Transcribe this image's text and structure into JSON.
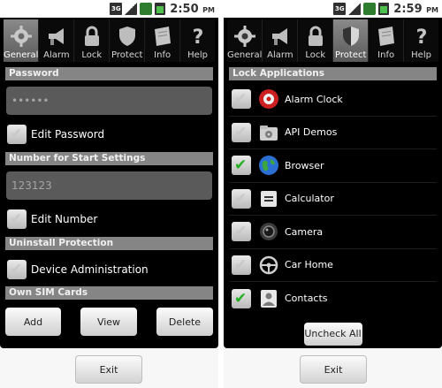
{
  "colors": {
    "screen_bg": "#000000",
    "section_header_bg": "#858585",
    "check_green": "#22b022",
    "active_tab_bg": "#6f6f6f"
  },
  "status_bar": {
    "left": {
      "time": "2:50",
      "ampm": "PM",
      "network": "3G"
    },
    "right": {
      "time": "2:59",
      "ampm": "PM",
      "network": "3G"
    }
  },
  "tabs": [
    {
      "label": "General",
      "icon": "gear-icon"
    },
    {
      "label": "Alarm",
      "icon": "megaphone-icon"
    },
    {
      "label": "Lock",
      "icon": "padlock-icon"
    },
    {
      "label": "Protect",
      "icon": "shield-icon"
    },
    {
      "label": "Info",
      "icon": "paper-icon"
    },
    {
      "label": "Help",
      "icon": "question-icon"
    }
  ],
  "left_screen": {
    "active_tab": "General",
    "password_header": "Password",
    "password_value": "••••••",
    "edit_password_label": "Edit Password",
    "edit_password_checked": false,
    "start_settings_header": "Number for Start Settings",
    "number_placeholder": "123123",
    "edit_number_label": "Edit Number",
    "edit_number_checked": false,
    "uninstall_header": "Uninstall Protection",
    "device_admin_label": "Device Administration",
    "device_admin_checked": false,
    "sim_header": "Own SIM Cards",
    "add_label": "Add",
    "view_label": "View",
    "delete_label": "Delete",
    "exit_label": "Exit"
  },
  "right_screen": {
    "active_tab": "Protect",
    "lock_header": "Lock Applications",
    "apps": [
      {
        "name": "Alarm Clock",
        "checked": false,
        "icon": "alarm-clock-icon"
      },
      {
        "name": "API Demos",
        "checked": false,
        "icon": "folder-icon"
      },
      {
        "name": "Browser",
        "checked": true,
        "icon": "globe-icon"
      },
      {
        "name": "Calculator",
        "checked": false,
        "icon": "calculator-icon"
      },
      {
        "name": "Camera",
        "checked": false,
        "icon": "camera-icon"
      },
      {
        "name": "Car Home",
        "checked": false,
        "icon": "steering-wheel-icon"
      },
      {
        "name": "Contacts",
        "checked": true,
        "icon": "contacts-icon"
      }
    ],
    "uncheck_all_label": "Uncheck All",
    "exit_label": "Exit"
  }
}
